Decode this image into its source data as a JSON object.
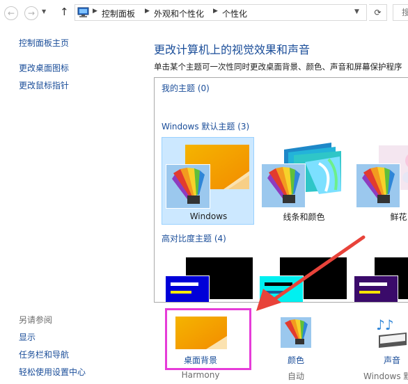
{
  "address_bar": {
    "breadcrumbs": [
      "控制面板",
      "外观和个性化",
      "个性化"
    ],
    "search_placeholder": "搜"
  },
  "sidebar": {
    "home": "控制面板主页",
    "links": [
      "更改桌面图标",
      "更改鼠标指针"
    ],
    "see_also_title": "另请参阅",
    "see_also": [
      "显示",
      "任务栏和导航",
      "轻松使用设置中心"
    ]
  },
  "main": {
    "title": "更改计算机上的视觉效果和声音",
    "description": "单击某个主题可一次性同时更改桌面背景、颜色、声音和屏幕保护程序",
    "groups": {
      "my_themes": "我的主题 (0)",
      "default_themes": "Windows 默认主题 (3)",
      "high_contrast": "高对比度主题 (4)"
    },
    "themes": [
      {
        "name": "Windows",
        "selected": true
      },
      {
        "name": "线条和颜色",
        "selected": false
      },
      {
        "name": "鲜花",
        "selected": false
      }
    ]
  },
  "bottom": {
    "background": {
      "label": "桌面背景",
      "sub": "Harmony"
    },
    "color": {
      "label": "颜色",
      "sub": "自动"
    },
    "sound": {
      "label": "声音",
      "sub": "Windows 默认"
    }
  },
  "colors": {
    "link": "#1a4d99",
    "selection": "#cce8ff",
    "highlight_box": "#e63cd8",
    "arrow": "#e8433a"
  }
}
